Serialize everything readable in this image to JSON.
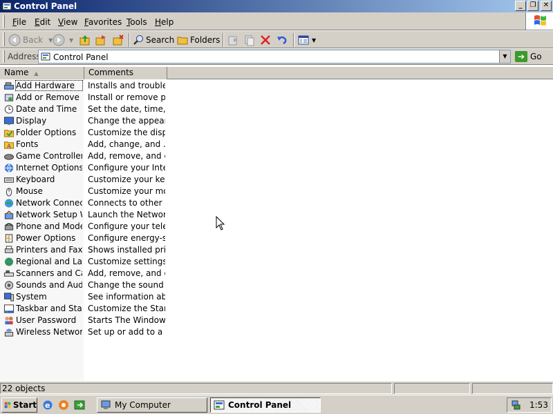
{
  "window": {
    "title": "Control Panel"
  },
  "menu": [
    {
      "label": "File",
      "key": "F",
      "rest": "ile"
    },
    {
      "label": "Edit",
      "key": "E",
      "rest": "dit"
    },
    {
      "label": "View",
      "key": "V",
      "rest": "iew"
    },
    {
      "label": "Favorites",
      "key": "F",
      "rest": "avorites"
    },
    {
      "label": "Tools",
      "key": "T",
      "rest": "ools"
    },
    {
      "label": "Help",
      "key": "H",
      "rest": "elp"
    }
  ],
  "toolbar": {
    "back_label": "Back",
    "search_label": "Search",
    "folders_label": "Folders"
  },
  "address": {
    "label": "Address",
    "value": "Control Panel",
    "go_label": "Go"
  },
  "columns": {
    "name": "Name",
    "comments": "Comments"
  },
  "items": [
    {
      "name": "Add Hardware",
      "comment": "Installs and trouble...",
      "icon": "add-hardware-icon"
    },
    {
      "name": "Add or Remove P...",
      "comment": "Install or remove pr...",
      "icon": "add-remove-programs-icon"
    },
    {
      "name": "Date and Time",
      "comment": "Set the date, time, ...",
      "icon": "date-time-icon"
    },
    {
      "name": "Display",
      "comment": "Change the appear...",
      "icon": "display-icon"
    },
    {
      "name": "Folder Options",
      "comment": "Customize the displ...",
      "icon": "folder-options-icon"
    },
    {
      "name": "Fonts",
      "comment": "Add, change, and ...",
      "icon": "fonts-icon"
    },
    {
      "name": "Game Controllers",
      "comment": "Add, remove, and c...",
      "icon": "game-controllers-icon"
    },
    {
      "name": "Internet Options",
      "comment": "Configure your Inte...",
      "icon": "internet-options-icon"
    },
    {
      "name": "Keyboard",
      "comment": "Customize your key...",
      "icon": "keyboard-icon"
    },
    {
      "name": "Mouse",
      "comment": "Customize your mo...",
      "icon": "mouse-icon"
    },
    {
      "name": "Network Connect...",
      "comment": "Connects to other c...",
      "icon": "network-connections-icon"
    },
    {
      "name": "Network Setup W...",
      "comment": "Launch the Network...",
      "icon": "network-setup-icon"
    },
    {
      "name": "Phone and Mode...",
      "comment": "Configure your tele...",
      "icon": "phone-modem-icon"
    },
    {
      "name": "Power Options",
      "comment": "Configure energy-s...",
      "icon": "power-options-icon"
    },
    {
      "name": "Printers and Faxes",
      "comment": "Shows installed prin...",
      "icon": "printers-faxes-icon"
    },
    {
      "name": "Regional and Lan...",
      "comment": "Customize settings ...",
      "icon": "regional-language-icon"
    },
    {
      "name": "Scanners and Ca...",
      "comment": "Add, remove, and c...",
      "icon": "scanners-cameras-icon"
    },
    {
      "name": "Sounds and Audi...",
      "comment": "Change the sound s...",
      "icon": "sounds-audio-icon"
    },
    {
      "name": "System",
      "comment": "See information abo...",
      "icon": "system-icon"
    },
    {
      "name": "Taskbar and Star...",
      "comment": "Customize the Start...",
      "icon": "taskbar-start-icon"
    },
    {
      "name": "User Password",
      "comment": "Starts The Windows...",
      "icon": "user-password-icon"
    },
    {
      "name": "Wireless Network...",
      "comment": "Set up or add to a ...",
      "icon": "wireless-network-icon"
    }
  ],
  "status": {
    "objects": "22 objects"
  },
  "taskbar": {
    "start_label": "Start",
    "tasks": [
      {
        "label": "My Computer",
        "active": false
      },
      {
        "label": "Control Panel",
        "active": true
      }
    ],
    "clock": "1:53"
  }
}
